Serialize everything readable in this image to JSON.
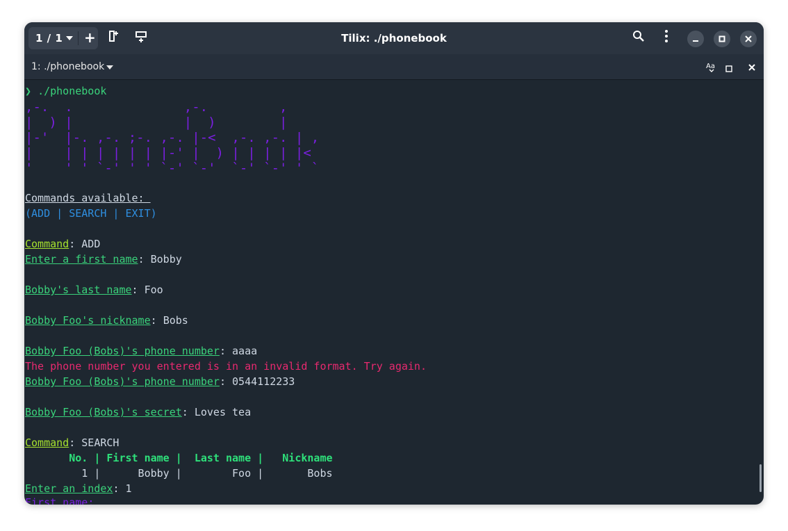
{
  "window": {
    "title": "Tilix: ./phonebook"
  },
  "header": {
    "session_label": "1 / 1"
  },
  "tab": {
    "label": "1: ./phonebook"
  },
  "terminal": {
    "prompt_symbol": "❯",
    "prompt_cmd": "./phonebook",
    "banner": [
      ",-.  .              ,-.         ,",
      "|  ) |              |  )        |",
      "|-'  |-. ,-. ;-. ,-. |-<  ,-. ,-. | ,",
      "|    | | | | | | |-' |  ) | | | | |<",
      "'    ' ' `-' ' ' `-' `-'  `-' `-' ' `"
    ],
    "commands_header": "Commands available: ",
    "commands_list": "(ADD | SEARCH | EXIT)",
    "entries": [
      {
        "label": "Command",
        "value": "ADD",
        "label_color": "y"
      },
      {
        "label": "Enter a first name",
        "value": "Bobby",
        "label_color": "g"
      },
      {
        "label": "Bobby's last name",
        "value": "Foo",
        "label_color": "g"
      },
      {
        "label": "Bobby Foo's nickname",
        "value": "Bobs",
        "label_color": "g"
      },
      {
        "label": "Bobby Foo (Bobs)'s phone number",
        "value": "aaaa",
        "label_color": "g"
      },
      {
        "label": "Bobby Foo (Bobs)'s phone number",
        "value": "0544112233",
        "label_color": "g"
      },
      {
        "label": "Bobby Foo (Bobs)'s secret",
        "value": "Loves tea",
        "label_color": "g"
      },
      {
        "label": "Command",
        "value": "SEARCH",
        "label_color": "y"
      },
      {
        "label": "Enter an index",
        "value": "1",
        "label_color": "g"
      },
      {
        "label": "First name",
        "value": "",
        "label_color": "p"
      }
    ],
    "error": "The phone number you entered is in an invalid format. Try again.",
    "table_header": "       No. | First name |  Last name |   Nickname",
    "table_row": "         1 |      Bobby |        Foo |       Bobs",
    "sep": ": "
  }
}
